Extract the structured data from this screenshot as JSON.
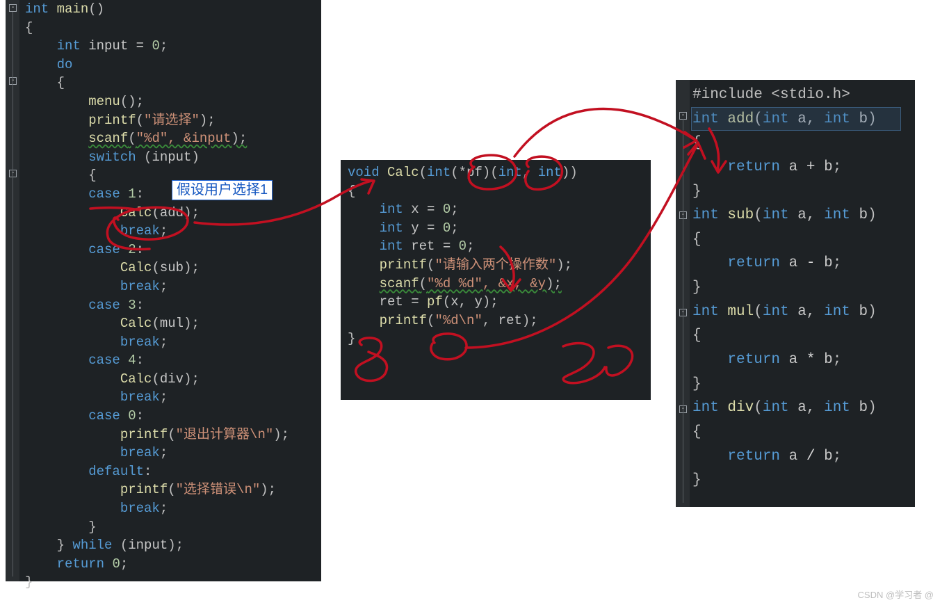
{
  "panel_left": {
    "fold_sign": "-",
    "lines": [
      [
        {
          "t": "int ",
          "c": "kw"
        },
        {
          "t": "main",
          "c": "fn"
        },
        {
          "t": "()",
          "c": "pun"
        }
      ],
      [
        {
          "t": "{",
          "c": "pun"
        }
      ],
      [
        {
          "t": "    ",
          "c": ""
        },
        {
          "t": "int ",
          "c": "kw"
        },
        {
          "t": "input",
          "c": "id"
        },
        {
          "t": " = ",
          "c": "op"
        },
        {
          "t": "0",
          "c": "num"
        },
        {
          "t": ";",
          "c": "pun"
        }
      ],
      [
        {
          "t": "    ",
          "c": ""
        },
        {
          "t": "do",
          "c": "kw"
        }
      ],
      [
        {
          "t": "    {",
          "c": "pun"
        }
      ],
      [
        {
          "t": "        ",
          "c": ""
        },
        {
          "t": "menu",
          "c": "fn"
        },
        {
          "t": "();",
          "c": "pun"
        }
      ],
      [
        {
          "t": "        ",
          "c": ""
        },
        {
          "t": "printf",
          "c": "fn"
        },
        {
          "t": "(",
          "c": "pun"
        },
        {
          "t": "\"请选择\"",
          "c": "str"
        },
        {
          "t": ");",
          "c": "pun"
        }
      ],
      [
        {
          "t": "        ",
          "c": ""
        },
        {
          "t": "scanf",
          "c": "fn wavy"
        },
        {
          "t": "(",
          "c": "pun wavy"
        },
        {
          "t": "\"%d\", &input",
          "c": "str wavy"
        },
        {
          "t": ");",
          "c": "pun wavy"
        }
      ],
      [
        {
          "t": "        ",
          "c": ""
        },
        {
          "t": "switch",
          "c": "kw"
        },
        {
          "t": " (",
          "c": "pun"
        },
        {
          "t": "input",
          "c": "id"
        },
        {
          "t": ")",
          "c": "pun"
        }
      ],
      [
        {
          "t": "        {",
          "c": "pun"
        }
      ],
      [
        {
          "t": "        ",
          "c": ""
        },
        {
          "t": "case",
          "c": "kw"
        },
        {
          "t": " ",
          "c": ""
        },
        {
          "t": "1",
          "c": "num"
        },
        {
          "t": ":",
          "c": "pun"
        }
      ],
      [
        {
          "t": "            ",
          "c": ""
        },
        {
          "t": "Calc",
          "c": "fn"
        },
        {
          "t": "(",
          "c": "pun"
        },
        {
          "t": "add",
          "c": "id"
        },
        {
          "t": ");",
          "c": "pun"
        }
      ],
      [
        {
          "t": "            ",
          "c": ""
        },
        {
          "t": "break",
          "c": "kw"
        },
        {
          "t": ";",
          "c": "pun"
        }
      ],
      [
        {
          "t": "        ",
          "c": ""
        },
        {
          "t": "case",
          "c": "kw"
        },
        {
          "t": " ",
          "c": ""
        },
        {
          "t": "2",
          "c": "num"
        },
        {
          "t": ":",
          "c": "pun"
        }
      ],
      [
        {
          "t": "            ",
          "c": ""
        },
        {
          "t": "Calc",
          "c": "fn"
        },
        {
          "t": "(",
          "c": "pun"
        },
        {
          "t": "sub",
          "c": "id"
        },
        {
          "t": ");",
          "c": "pun"
        }
      ],
      [
        {
          "t": "            ",
          "c": ""
        },
        {
          "t": "break",
          "c": "kw"
        },
        {
          "t": ";",
          "c": "pun"
        }
      ],
      [
        {
          "t": "        ",
          "c": ""
        },
        {
          "t": "case",
          "c": "kw"
        },
        {
          "t": " ",
          "c": ""
        },
        {
          "t": "3",
          "c": "num"
        },
        {
          "t": ":",
          "c": "pun"
        }
      ],
      [
        {
          "t": "            ",
          "c": ""
        },
        {
          "t": "Calc",
          "c": "fn"
        },
        {
          "t": "(",
          "c": "pun"
        },
        {
          "t": "mul",
          "c": "id"
        },
        {
          "t": ");",
          "c": "pun"
        }
      ],
      [
        {
          "t": "            ",
          "c": ""
        },
        {
          "t": "break",
          "c": "kw"
        },
        {
          "t": ";",
          "c": "pun"
        }
      ],
      [
        {
          "t": "        ",
          "c": ""
        },
        {
          "t": "case",
          "c": "kw"
        },
        {
          "t": " ",
          "c": ""
        },
        {
          "t": "4",
          "c": "num"
        },
        {
          "t": ":",
          "c": "pun"
        }
      ],
      [
        {
          "t": "            ",
          "c": ""
        },
        {
          "t": "Calc",
          "c": "fn"
        },
        {
          "t": "(",
          "c": "pun"
        },
        {
          "t": "div",
          "c": "id"
        },
        {
          "t": ");",
          "c": "pun"
        }
      ],
      [
        {
          "t": "            ",
          "c": ""
        },
        {
          "t": "break",
          "c": "kw"
        },
        {
          "t": ";",
          "c": "pun"
        }
      ],
      [
        {
          "t": "        ",
          "c": ""
        },
        {
          "t": "case",
          "c": "kw"
        },
        {
          "t": " ",
          "c": ""
        },
        {
          "t": "0",
          "c": "num"
        },
        {
          "t": ":",
          "c": "pun"
        }
      ],
      [
        {
          "t": "            ",
          "c": ""
        },
        {
          "t": "printf",
          "c": "fn"
        },
        {
          "t": "(",
          "c": "pun"
        },
        {
          "t": "\"退出计算器\\n\"",
          "c": "str"
        },
        {
          "t": ");",
          "c": "pun"
        }
      ],
      [
        {
          "t": "            ",
          "c": ""
        },
        {
          "t": "break",
          "c": "kw"
        },
        {
          "t": ";",
          "c": "pun"
        }
      ],
      [
        {
          "t": "        ",
          "c": ""
        },
        {
          "t": "default",
          "c": "kw"
        },
        {
          "t": ":",
          "c": "pun"
        }
      ],
      [
        {
          "t": "            ",
          "c": ""
        },
        {
          "t": "printf",
          "c": "fn"
        },
        {
          "t": "(",
          "c": "pun"
        },
        {
          "t": "\"选择错误\\n\"",
          "c": "str"
        },
        {
          "t": ");",
          "c": "pun"
        }
      ],
      [
        {
          "t": "            ",
          "c": ""
        },
        {
          "t": "break",
          "c": "kw"
        },
        {
          "t": ";",
          "c": "pun"
        }
      ],
      [
        {
          "t": "        }",
          "c": "pun"
        }
      ],
      [
        {
          "t": "    } ",
          "c": "pun"
        },
        {
          "t": "while",
          "c": "kw"
        },
        {
          "t": " (",
          "c": "pun"
        },
        {
          "t": "input",
          "c": "id"
        },
        {
          "t": ");",
          "c": "pun"
        }
      ],
      [
        {
          "t": "    ",
          "c": ""
        },
        {
          "t": "return",
          "c": "kw"
        },
        {
          "t": " ",
          "c": ""
        },
        {
          "t": "0",
          "c": "num"
        },
        {
          "t": ";",
          "c": "pun"
        }
      ],
      [
        {
          "t": "}",
          "c": "pun"
        }
      ]
    ]
  },
  "panel_mid": {
    "lines": [
      [
        {
          "t": "void ",
          "c": "kw"
        },
        {
          "t": "Calc",
          "c": "fn"
        },
        {
          "t": "(",
          "c": "pun"
        },
        {
          "t": "int",
          "c": "kw"
        },
        {
          "t": "(*",
          "c": "pun"
        },
        {
          "t": "pf",
          "c": "id"
        },
        {
          "t": ")(",
          "c": "pun"
        },
        {
          "t": "int",
          "c": "kw"
        },
        {
          "t": ", ",
          "c": "pun"
        },
        {
          "t": "int",
          "c": "kw"
        },
        {
          "t": "))",
          "c": "pun"
        }
      ],
      [
        {
          "t": "{",
          "c": "pun"
        }
      ],
      [
        {
          "t": "    ",
          "c": ""
        },
        {
          "t": "int ",
          "c": "kw"
        },
        {
          "t": "x",
          "c": "id"
        },
        {
          "t": " = ",
          "c": "op"
        },
        {
          "t": "0",
          "c": "num"
        },
        {
          "t": ";",
          "c": "pun"
        }
      ],
      [
        {
          "t": "    ",
          "c": ""
        },
        {
          "t": "int ",
          "c": "kw"
        },
        {
          "t": "y",
          "c": "id"
        },
        {
          "t": " = ",
          "c": "op"
        },
        {
          "t": "0",
          "c": "num"
        },
        {
          "t": ";",
          "c": "pun"
        }
      ],
      [
        {
          "t": "    ",
          "c": ""
        },
        {
          "t": "int ",
          "c": "kw"
        },
        {
          "t": "ret",
          "c": "id"
        },
        {
          "t": " = ",
          "c": "op"
        },
        {
          "t": "0",
          "c": "num"
        },
        {
          "t": ";",
          "c": "pun"
        }
      ],
      [
        {
          "t": "    ",
          "c": ""
        },
        {
          "t": "printf",
          "c": "fn"
        },
        {
          "t": "(",
          "c": "pun"
        },
        {
          "t": "\"请输入两个操作数\"",
          "c": "str"
        },
        {
          "t": ");",
          "c": "pun"
        }
      ],
      [
        {
          "t": "    ",
          "c": ""
        },
        {
          "t": "scanf",
          "c": "fn wavy"
        },
        {
          "t": "(",
          "c": "pun wavy"
        },
        {
          "t": "\"%d %d\", &x, &y",
          "c": "str wavy"
        },
        {
          "t": ");",
          "c": "pun wavy"
        }
      ],
      [
        {
          "t": "    ",
          "c": ""
        },
        {
          "t": "ret",
          "c": "id"
        },
        {
          "t": " = ",
          "c": "op"
        },
        {
          "t": "pf",
          "c": "fn"
        },
        {
          "t": "(",
          "c": "pun"
        },
        {
          "t": "x",
          "c": "id"
        },
        {
          "t": ", ",
          "c": "pun"
        },
        {
          "t": "y",
          "c": "id"
        },
        {
          "t": ");",
          "c": "pun"
        }
      ],
      [
        {
          "t": "    ",
          "c": ""
        },
        {
          "t": "printf",
          "c": "fn"
        },
        {
          "t": "(",
          "c": "pun"
        },
        {
          "t": "\"%d\\n\"",
          "c": "str"
        },
        {
          "t": ", ",
          "c": "pun"
        },
        {
          "t": "ret",
          "c": "id"
        },
        {
          "t": ");",
          "c": "pun"
        }
      ],
      [
        {
          "t": "}",
          "c": "pun"
        }
      ]
    ]
  },
  "panel_right": {
    "fold_sign": "-",
    "lines": [
      [
        {
          "t": "#include <stdio.h>",
          "c": "pun"
        }
      ],
      [
        {
          "t": "int ",
          "c": "kw"
        },
        {
          "t": "add",
          "c": "fn"
        },
        {
          "t": "(",
          "c": "pun"
        },
        {
          "t": "int ",
          "c": "kw"
        },
        {
          "t": "a",
          "c": "id"
        },
        {
          "t": ", ",
          "c": "pun"
        },
        {
          "t": "int ",
          "c": "kw"
        },
        {
          "t": "b",
          "c": "id"
        },
        {
          "t": ")",
          "c": "pun"
        }
      ],
      [
        {
          "t": "{",
          "c": "pun"
        }
      ],
      [
        {
          "t": "    ",
          "c": ""
        },
        {
          "t": "return",
          "c": "kw"
        },
        {
          "t": " ",
          "c": ""
        },
        {
          "t": "a",
          "c": "id"
        },
        {
          "t": " + ",
          "c": "op"
        },
        {
          "t": "b",
          "c": "id"
        },
        {
          "t": ";",
          "c": "pun"
        }
      ],
      [
        {
          "t": "}",
          "c": "pun"
        }
      ],
      [
        {
          "t": "int ",
          "c": "kw"
        },
        {
          "t": "sub",
          "c": "fn"
        },
        {
          "t": "(",
          "c": "pun"
        },
        {
          "t": "int ",
          "c": "kw"
        },
        {
          "t": "a",
          "c": "id"
        },
        {
          "t": ", ",
          "c": "pun"
        },
        {
          "t": "int ",
          "c": "kw"
        },
        {
          "t": "b",
          "c": "id"
        },
        {
          "t": ")",
          "c": "pun"
        }
      ],
      [
        {
          "t": "{",
          "c": "pun"
        }
      ],
      [
        {
          "t": "    ",
          "c": ""
        },
        {
          "t": "return",
          "c": "kw"
        },
        {
          "t": " ",
          "c": ""
        },
        {
          "t": "a",
          "c": "id"
        },
        {
          "t": " - ",
          "c": "op"
        },
        {
          "t": "b",
          "c": "id"
        },
        {
          "t": ";",
          "c": "pun"
        }
      ],
      [
        {
          "t": "}",
          "c": "pun"
        }
      ],
      [
        {
          "t": "int ",
          "c": "kw"
        },
        {
          "t": "mul",
          "c": "fn"
        },
        {
          "t": "(",
          "c": "pun"
        },
        {
          "t": "int ",
          "c": "kw"
        },
        {
          "t": "a",
          "c": "id"
        },
        {
          "t": ", ",
          "c": "pun"
        },
        {
          "t": "int ",
          "c": "kw"
        },
        {
          "t": "b",
          "c": "id"
        },
        {
          "t": ")",
          "c": "pun"
        }
      ],
      [
        {
          "t": "{",
          "c": "pun"
        }
      ],
      [
        {
          "t": "    ",
          "c": ""
        },
        {
          "t": "return",
          "c": "kw"
        },
        {
          "t": " ",
          "c": ""
        },
        {
          "t": "a",
          "c": "id"
        },
        {
          "t": " * ",
          "c": "op"
        },
        {
          "t": "b",
          "c": "id"
        },
        {
          "t": ";",
          "c": "pun"
        }
      ],
      [
        {
          "t": "}",
          "c": "pun"
        }
      ],
      [
        {
          "t": "int ",
          "c": "kw"
        },
        {
          "t": "div",
          "c": "fn"
        },
        {
          "t": "(",
          "c": "pun"
        },
        {
          "t": "int ",
          "c": "kw"
        },
        {
          "t": "a",
          "c": "id"
        },
        {
          "t": ", ",
          "c": "pun"
        },
        {
          "t": "int ",
          "c": "kw"
        },
        {
          "t": "b",
          "c": "id"
        },
        {
          "t": ")",
          "c": "pun"
        }
      ],
      [
        {
          "t": "{",
          "c": "pun"
        }
      ],
      [
        {
          "t": "    ",
          "c": ""
        },
        {
          "t": "return",
          "c": "kw"
        },
        {
          "t": " ",
          "c": ""
        },
        {
          "t": "a",
          "c": "id"
        },
        {
          "t": " / ",
          "c": "op"
        },
        {
          "t": "b",
          "c": "id"
        },
        {
          "t": ";",
          "c": "pun"
        }
      ],
      [
        {
          "t": "}",
          "c": "pun"
        }
      ]
    ]
  },
  "annotation_bubble": "假设用户选择1",
  "watermark": "CSDN @学习者 @"
}
